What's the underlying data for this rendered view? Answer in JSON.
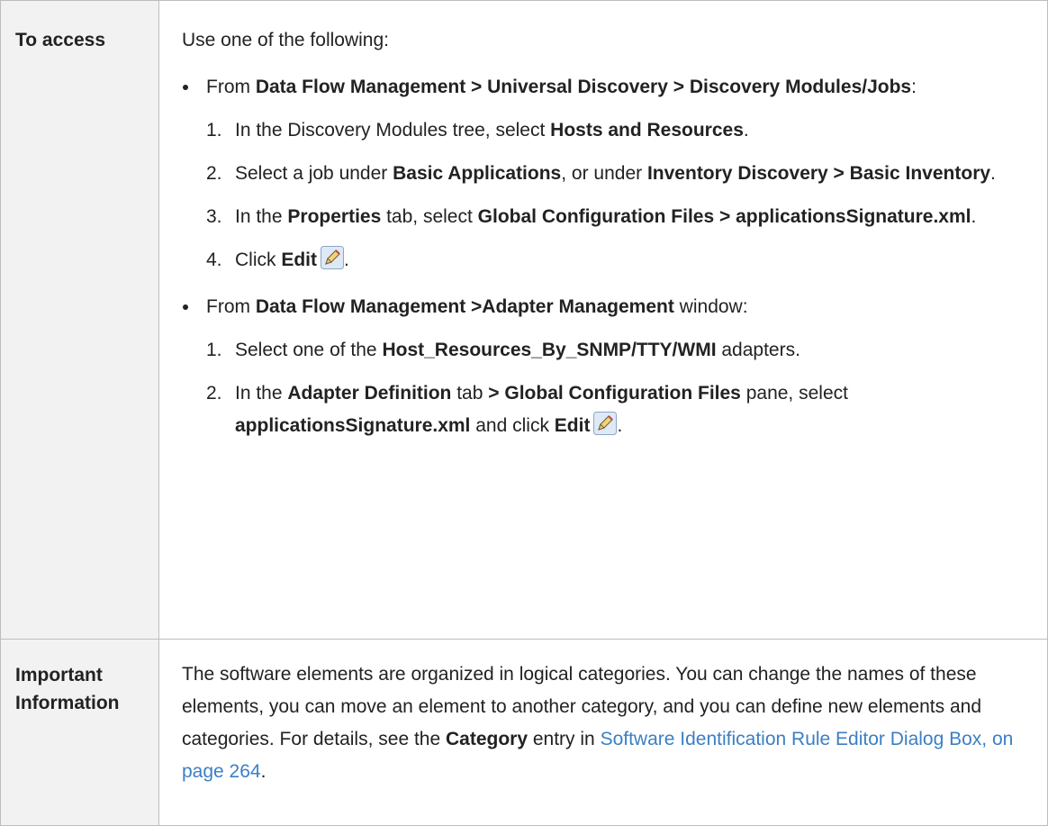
{
  "access": {
    "label": "To access",
    "intro": "Use one of the following:",
    "path1": {
      "prefix": "From ",
      "bold": "Data Flow Management > Universal Discovery > Discovery Modules/Jobs",
      "suffix": ":",
      "step1": {
        "num": "1.",
        "a": "In the Discovery Modules tree, select ",
        "b": "Hosts and Resources",
        "c": "."
      },
      "step2": {
        "num": "2.",
        "a": "Select a job under ",
        "b": "Basic Applications",
        "c": ", or under ",
        "d": "Inventory Discovery > Basic Inventory",
        "e": "."
      },
      "step3": {
        "num": "3.",
        "a": "In the ",
        "b": "Properties",
        "c": " tab, select ",
        "d": "Global Configuration Files > applicationsSignature.xml",
        "e": "."
      },
      "step4": {
        "num": "4.",
        "a": "Click ",
        "b": "Edit",
        "c": "."
      }
    },
    "path2": {
      "prefix": "From ",
      "bold": "Data Flow Management >Adapter Management",
      "suffix": " window:",
      "step1": {
        "num": "1.",
        "a": "Select one of the ",
        "b": "Host_Resources_By_SNMP/TTY/WMI",
        "c": " adapters."
      },
      "step2": {
        "num": "2.",
        "a": "In the ",
        "b": "Adapter Definition",
        "c": " tab ",
        "d": "> Global Configuration Files",
        "e": " pane, select ",
        "f": "applicationsSignature.xml",
        "g": " and click ",
        "h": "Edit",
        "i": "."
      }
    }
  },
  "info": {
    "label_line1": "Important",
    "label_line2": "Information",
    "text_a": "The software elements are organized in logical categories. You can change the names of these elements, you can move an element to another category, and you can define new elements and categories. For details, see the ",
    "text_b": "Category",
    "text_c": " entry in ",
    "link": "Software Identification Rule Editor Dialog Box, on page 264",
    "text_d": "."
  },
  "icons": {
    "edit": "pencil-edit-icon"
  }
}
